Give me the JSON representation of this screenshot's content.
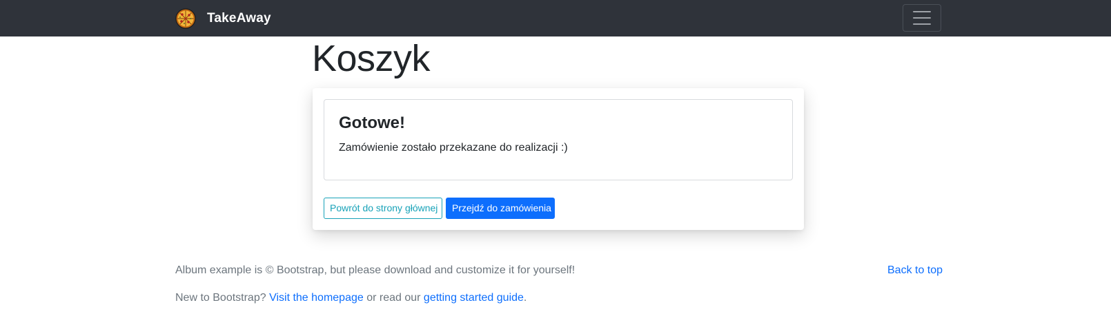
{
  "navbar": {
    "brand_name": "TakeAway",
    "logo_icon": "pizza-icon",
    "toggler_icon": "hamburger-menu-icon",
    "background": "#2f333a"
  },
  "main": {
    "page_title": "Koszyk",
    "card": {
      "heading": "Gotowe!",
      "message": "Zamówienie zostało przekazane do realizacji :)",
      "back_button_label": "Powrót do strony głównej",
      "order_button_label": "Przejdź do zamówienia"
    }
  },
  "footer": {
    "line1": "Album example is © Bootstrap, but please download and customize it for yourself!",
    "back_to_top": "Back to top",
    "line2_prefix": "New to Bootstrap? ",
    "homepage_link": "Visit the homepage",
    "line2_middle": " or read our ",
    "guide_link": "getting started guide",
    "line2_suffix": "."
  },
  "colors": {
    "primary": "#0d6efd",
    "info": "#17a2b8",
    "muted": "#6c757d"
  }
}
